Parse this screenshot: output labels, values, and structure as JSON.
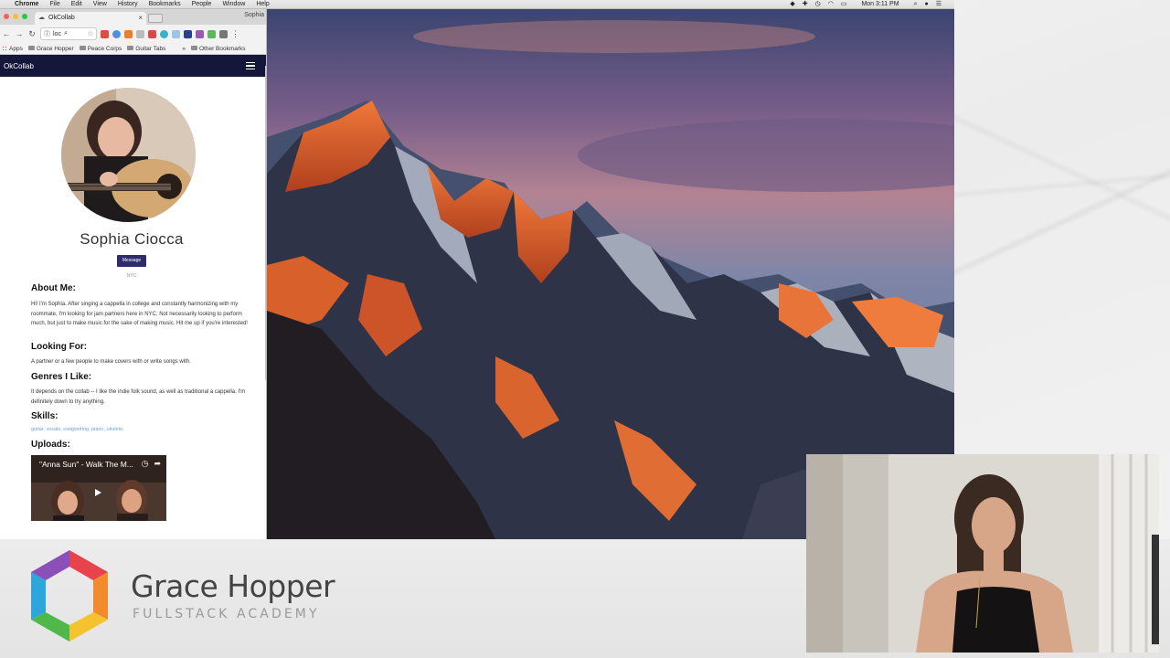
{
  "menubar": {
    "app_name": "Chrome",
    "menus": [
      "File",
      "Edit",
      "View",
      "History",
      "Bookmarks",
      "People",
      "Window",
      "Help"
    ],
    "clock": "Mon 3:11 PM"
  },
  "browser": {
    "tab_title": "OkCollab",
    "profile_name": "Sophia",
    "omnibox_text": "loc",
    "bookmarks": [
      "Apps",
      "Grace Hopper",
      "Peace Corps",
      "Guitar Tabs"
    ],
    "bookmarks_overflow": "»",
    "other_bookmarks": "Other Bookmarks"
  },
  "app": {
    "brand": "OkCollab",
    "profile": {
      "name": "Sophia Ciocca",
      "message_button": "Message",
      "location": "NYC",
      "about_title": "About Me:",
      "about_text": "Hi! I'm Sophia. After singing a cappella in college and constantly harmonizing with my roommate, I'm looking for jam partners here in NYC. Not necessarily looking to perform much, but just to make music for the sake of making music. Hit me up if you're interested!",
      "looking_title": "Looking For:",
      "looking_text": "A partner or a few people to make covers with or write songs with.",
      "genres_title": "Genres I Like:",
      "genres_text": "It depends on the collab -- I like the indie folk sound, as well as traditional a cappella. I'm definitely down to try anything.",
      "skills_title": "Skills:",
      "skills": "guitar, vocals, songwriting, piano, ukulele,",
      "uploads_title": "Uploads:",
      "video_title": "\"Anna Sun\" - Walk The M..."
    }
  },
  "banner": {
    "title": "Grace Hopper",
    "subtitle": "FULLSTACK ACADEMY",
    "logo_colors": [
      "#e8434b",
      "#f28a2e",
      "#f6c330",
      "#4fb848",
      "#2fa6d9",
      "#8a4fb8"
    ]
  }
}
